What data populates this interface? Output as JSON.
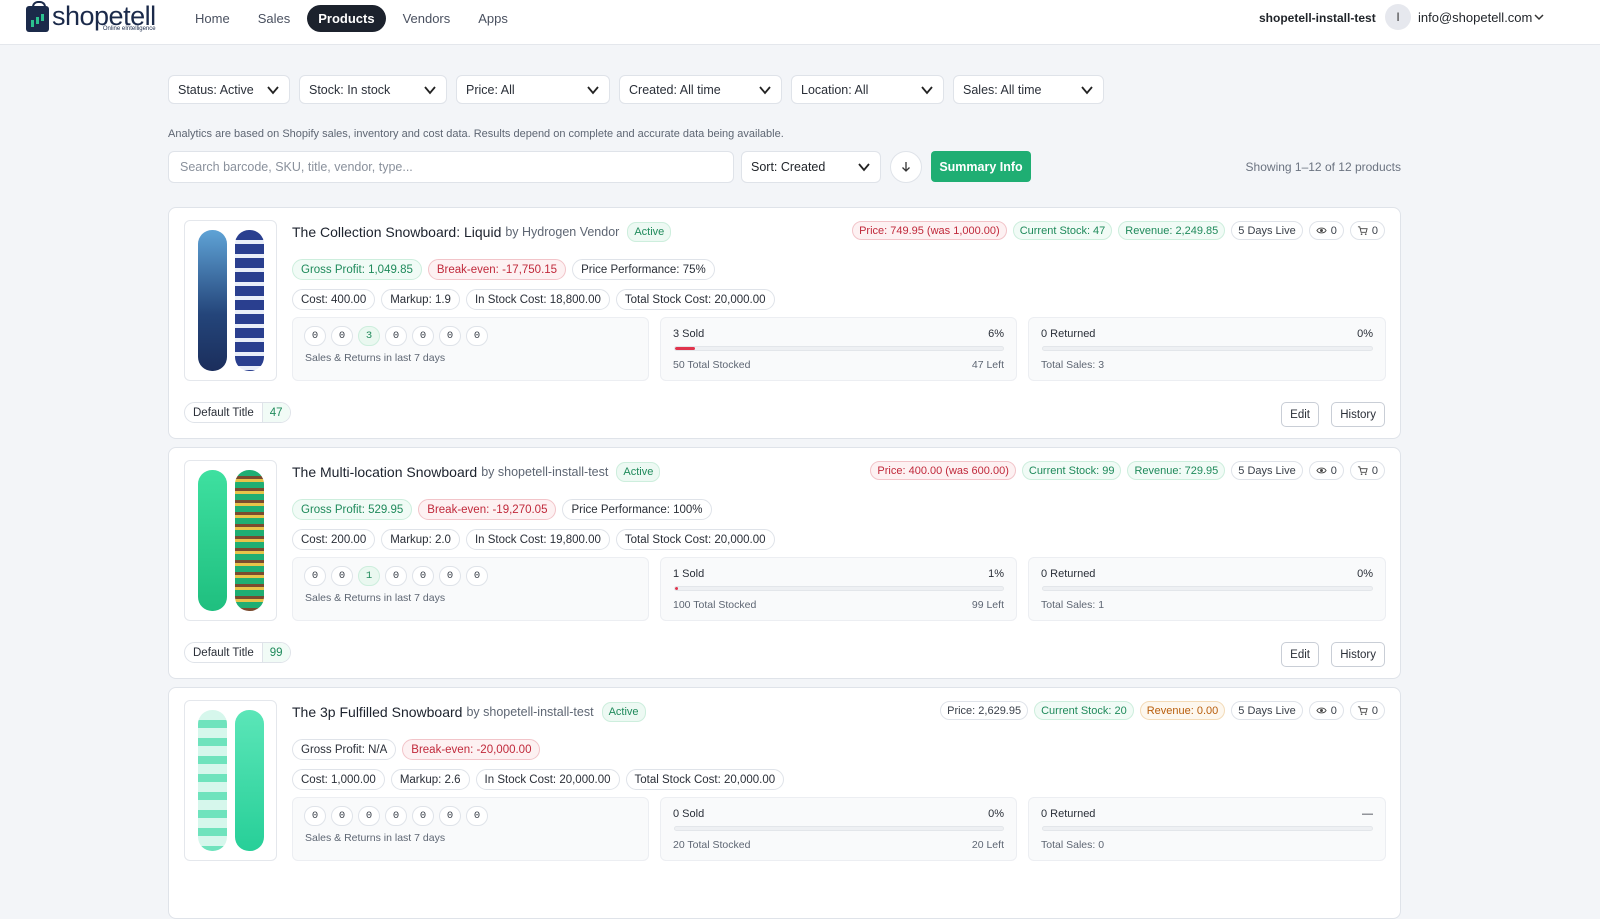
{
  "brand": {
    "name": "shopetell",
    "tagline": "Online eIntelligence",
    "accent": "#1fae73"
  },
  "nav": [
    {
      "label": "Home",
      "active": false
    },
    {
      "label": "Sales",
      "active": false
    },
    {
      "label": "Products",
      "active": true
    },
    {
      "label": "Vendors",
      "active": false
    },
    {
      "label": "Apps",
      "active": false
    }
  ],
  "account": {
    "store": "shopetell-install-test",
    "avatar_initial": "I",
    "email": "info@shopetell.com"
  },
  "filters": [
    {
      "label": "Status: Active"
    },
    {
      "label": "Stock: In stock"
    },
    {
      "label": "Price: All"
    },
    {
      "label": "Created: All time"
    },
    {
      "label": "Location: All"
    },
    {
      "label": "Sales: All time"
    }
  ],
  "disclaimer": "Analytics are based on Shopify sales, inventory and cost data. Results depend on complete and accurate data being available.",
  "search": {
    "placeholder": "Search barcode, SKU, title, vendor, type...",
    "value": ""
  },
  "sort": {
    "label": "Sort: Created",
    "direction_icon": "arrow-down-icon"
  },
  "summary_button": "Summary Info",
  "showing": "Showing 1–12 of 12 products",
  "products": [
    {
      "title": "The Collection Snowboard: Liquid",
      "by": "by Hydrogen Vendor",
      "status": "Active",
      "price": "Price: 749.95 (was 1,000.00)",
      "stock": "Current Stock: 47",
      "revenue": "Revenue: 2,249.85",
      "days_live": "5 Days Live",
      "views": "0",
      "carts": "0",
      "gross_profit": "Gross Profit: 1,049.85",
      "break_even": "Break-even: -17,750.15",
      "price_perf": "Price Performance: 75%",
      "cost": "Cost: 400.00",
      "markup": "Markup: 1.9",
      "in_stock_cost": "In Stock Cost: 18,800.00",
      "total_stock_cost": "Total Stock Cost: 20,000.00",
      "days": [
        "0",
        "0",
        "3",
        "0",
        "0",
        "0",
        "0"
      ],
      "days_label": "Sales & Returns in last 7 days",
      "sold": "3 Sold",
      "sold_pct": "6%",
      "sold_fraction": 0.06,
      "total_stocked": "50 Total Stocked",
      "left": "47 Left",
      "returned": "0 Returned",
      "returned_pct": "0%",
      "total_sales": "Total Sales: 3",
      "variant": "Default Title",
      "variant_qty": "47",
      "edit": "Edit",
      "history": "History",
      "colors": [
        "#24457a",
        "#2a3f8f"
      ]
    },
    {
      "title": "The Multi-location Snowboard",
      "by": "by shopetell-install-test",
      "status": "Active",
      "price": "Price: 400.00 (was 600.00)",
      "stock": "Current Stock: 99",
      "revenue": "Revenue: 729.95",
      "days_live": "5 Days Live",
      "views": "0",
      "carts": "0",
      "gross_profit": "Gross Profit: 529.95",
      "break_even": "Break-even: -19,270.05",
      "price_perf": "Price Performance: 100%",
      "cost": "Cost: 200.00",
      "markup": "Markup: 2.0",
      "in_stock_cost": "In Stock Cost: 19,800.00",
      "total_stock_cost": "Total Stock Cost: 20,000.00",
      "days": [
        "0",
        "0",
        "1",
        "0",
        "0",
        "0",
        "0"
      ],
      "days_label": "Sales & Returns in last 7 days",
      "sold": "1 Sold",
      "sold_pct": "1%",
      "sold_fraction": 0.01,
      "total_stocked": "100 Total Stocked",
      "left": "99 Left",
      "returned": "0 Returned",
      "returned_pct": "0%",
      "total_sales": "Total Sales: 1",
      "variant": "Default Title",
      "variant_qty": "99",
      "edit": "Edit",
      "history": "History",
      "colors": [
        "#2fd58f",
        "#1fae73"
      ]
    },
    {
      "title": "The 3p Fulfilled Snowboard",
      "by": "by shopetell-install-test",
      "status": "Active",
      "price": "Price: 2,629.95",
      "stock": "Current Stock: 20",
      "revenue": "Revenue: 0.00",
      "days_live": "5 Days Live",
      "views": "0",
      "carts": "0",
      "gross_profit": "Gross Profit: N/A",
      "break_even": "Break-even: -20,000.00",
      "cost": "Cost: 1,000.00",
      "markup": "Markup: 2.6",
      "in_stock_cost": "In Stock Cost: 20,000.00",
      "total_stock_cost": "Total Stock Cost: 20,000.00",
      "days": [
        "0",
        "0",
        "0",
        "0",
        "0",
        "0",
        "0"
      ],
      "days_label": "Sales & Returns in last 7 days",
      "sold": "0 Sold",
      "sold_pct": "0%",
      "sold_fraction": 0,
      "total_stocked": "20 Total Stocked",
      "left": "20 Left",
      "returned": "0 Returned",
      "returned_pct": "—",
      "total_sales": "Total Sales: 0",
      "colors": [
        "#bff3e3",
        "#3ed9a6"
      ]
    }
  ]
}
